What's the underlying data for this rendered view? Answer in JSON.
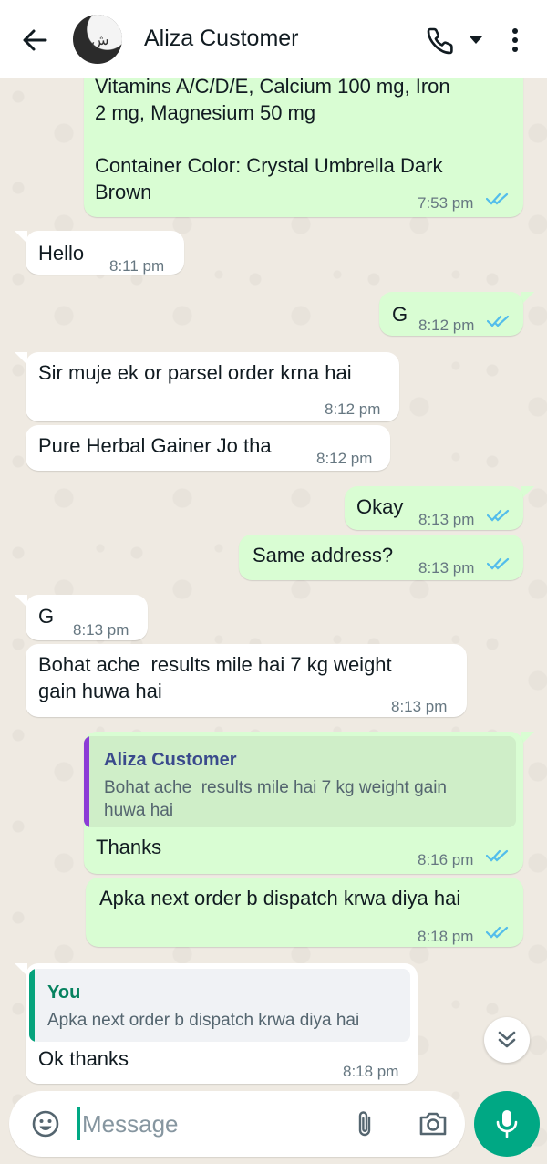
{
  "header": {
    "back_label": "back",
    "contact_name": "Aliza Customer",
    "icons": [
      "arrow-left-icon",
      "phone-icon",
      "caret-down-icon",
      "more-vert-icon"
    ]
  },
  "messages": [
    {
      "dir": "out",
      "text": "Vitamins A/C/D/E, Calcium 100 mg, Iron\n2 mg, Magnesium 50 mg\n\nContainer Color: Crystal Umbrella Dark\nBrown",
      "time": "7:53 pm",
      "read": true
    },
    {
      "dir": "in",
      "text": "Hello",
      "time": "8:11 pm"
    },
    {
      "dir": "out",
      "text": "G",
      "time": "8:12 pm",
      "read": true
    },
    {
      "dir": "in",
      "text": "Sir muje ek or parsel order krna hai",
      "time": "8:12 pm"
    },
    {
      "dir": "in",
      "text": "Pure Herbal Gainer Jo tha",
      "time": "8:12 pm"
    },
    {
      "dir": "out",
      "text": "Okay",
      "time": "8:13 pm",
      "read": true
    },
    {
      "dir": "out",
      "text": "Same address?",
      "time": "8:13 pm",
      "read": true
    },
    {
      "dir": "in",
      "text": "G",
      "time": "8:13 pm"
    },
    {
      "dir": "in",
      "text": "Bohat ache  results mile hai 7 kg weight\ngain huwa hai",
      "time": "8:13 pm"
    },
    {
      "dir": "out",
      "quote_author": "Aliza Customer",
      "quote_text": "Bohat ache  results mile hai 7 kg weight gain\nhuwa hai",
      "text": "Thanks",
      "time": "8:16 pm",
      "read": true
    },
    {
      "dir": "out",
      "text": "Apka next order b dispatch krwa diya hai",
      "time": "8:18 pm",
      "read": true
    },
    {
      "dir": "in",
      "quote_author": "You",
      "quote_text": "Apka next order b dispatch krwa diya hai",
      "text": "Ok thanks",
      "time": "8:18 pm"
    }
  ],
  "composer": {
    "placeholder": "Message",
    "icons": [
      "emoji-icon",
      "attach-icon",
      "camera-icon",
      "mic-icon"
    ]
  },
  "colors": {
    "accent": "#00a884",
    "outgoing_bubble": "#d9fdd3",
    "incoming_bubble": "#ffffff",
    "read_ticks": "#53bdeb",
    "chat_background": "#efeae2",
    "quote_in_chat_bar": "#8c3cd6",
    "quote_you_bar": "#06a37c"
  }
}
